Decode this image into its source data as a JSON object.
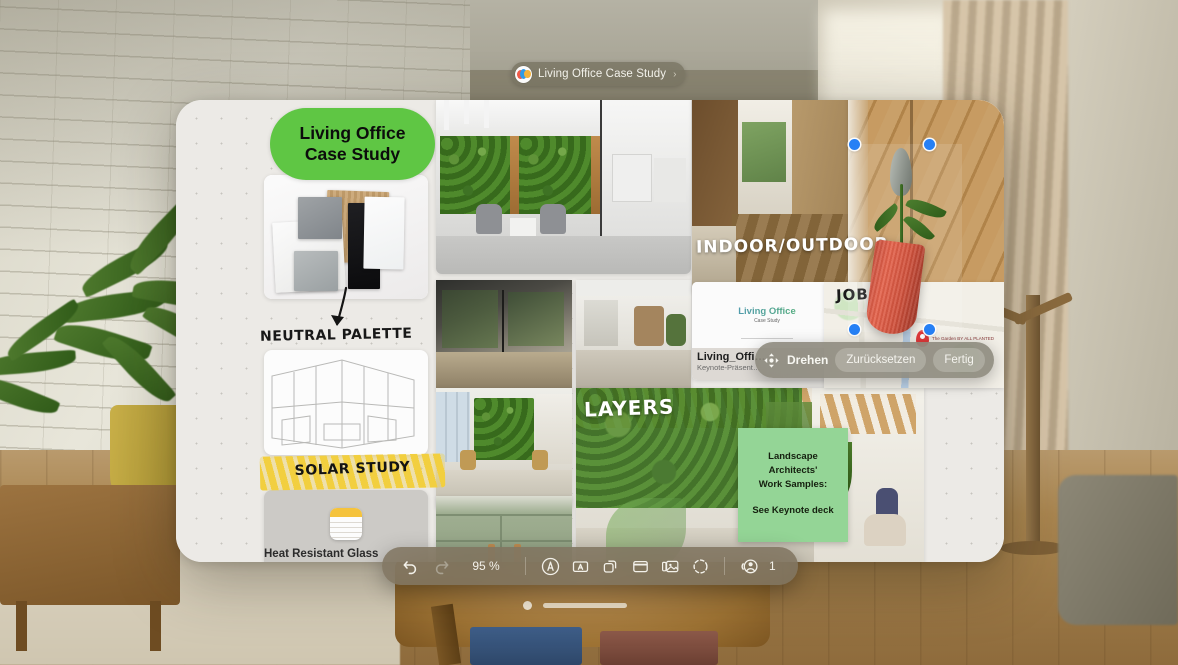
{
  "environment": {
    "name": "visionOS passthrough room",
    "elements": [
      "white-brick-wall",
      "wood-floor",
      "curtain",
      "potted-plant",
      "wood-bench",
      "round-coffee-table",
      "book-stack",
      "coat-rack"
    ]
  },
  "window_chip": {
    "app_icon": "freeform-app-icon",
    "title": "Living Office Case Study",
    "chevron": "›"
  },
  "board": {
    "pill_title": "Living Office\nCase Study",
    "pill_color": "#5fc644",
    "labels": {
      "neutral_palette": "NEUTRAL PALETTE",
      "solar_study": "SOLAR STUDY",
      "indoor_outdoor": "INDOOR/OUTDOOR",
      "job_site": "JOB SITE",
      "layers": "LAYERS"
    },
    "highlight_color": "#f2cf3f",
    "notes_attachment": {
      "icon": "notes-app-icon",
      "title": "Heat Resistant Glass"
    },
    "keynote_attachment": {
      "preview_title": "Living Office",
      "preview_subtitle": "Case Study",
      "filename": "Living_Offi…",
      "subtitle": "Keynote-Präsent…"
    },
    "map_card": {
      "pin": "map-pin",
      "business": "The Garden\nBY ALL PLANTED"
    },
    "sticky_note": {
      "color": "#94d596",
      "line1": "Landscape",
      "line2": "Architects'",
      "line3": "Work Samples:",
      "line4": "See Keynote deck"
    },
    "photos": [
      {
        "name": "office-green-wall-lounge"
      },
      {
        "name": "dark-glass-room"
      },
      {
        "name": "bright-lobby"
      },
      {
        "name": "green-wall-office-chairs"
      },
      {
        "name": "sage-green-cabinets"
      },
      {
        "name": "layered-plant-atrium"
      },
      {
        "name": "indoor-outdoor-walkway"
      },
      {
        "name": "wood-slat-wall"
      }
    ]
  },
  "selection": {
    "object": "3d-red-vase-with-flower",
    "handles": 4,
    "handle_color": "#2680f5"
  },
  "object_menu": {
    "move_icon": "move-arrows-icon",
    "rotate_label": "Drehen",
    "reset_label": "Zurücksetzen",
    "done_label": "Fertig"
  },
  "toolbar": {
    "undo": "undo-icon",
    "redo": "redo-icon",
    "zoom_level": "95 %",
    "tools": [
      {
        "name": "markup-pen-icon",
        "label": "Markup"
      },
      {
        "name": "text-box-icon",
        "label": "Text"
      },
      {
        "name": "shapes-icon",
        "label": "Shapes"
      },
      {
        "name": "sticky-note-icon",
        "label": "Sticky Note"
      },
      {
        "name": "media-photos-icon",
        "label": "Media"
      },
      {
        "name": "insert-3d-object-icon",
        "label": "3D Object"
      }
    ],
    "collab_icon": "collaboration-icon",
    "collab_count": "1"
  },
  "window_controls": {
    "close": "close-dot",
    "grabber": "window-resize-bar"
  }
}
